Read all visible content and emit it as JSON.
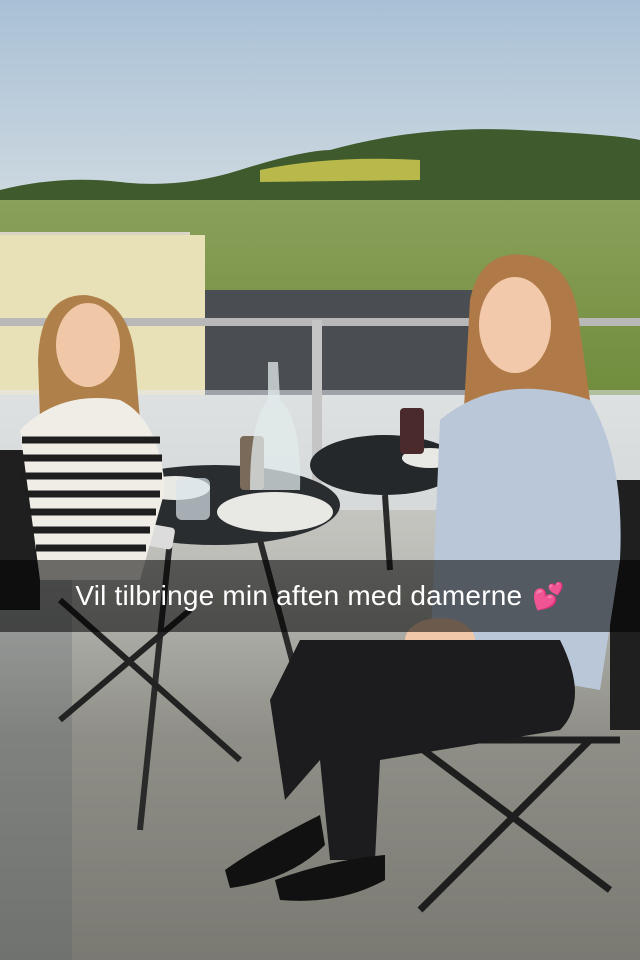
{
  "caption": {
    "text": "Vil tilbringe min aften med damerne",
    "emoji": "💕",
    "emoji_name": "two-hearts-icon"
  },
  "colors": {
    "caption_bar": "#000000",
    "caption_text": "#ffffff",
    "emoji": "#ff4fa8"
  }
}
